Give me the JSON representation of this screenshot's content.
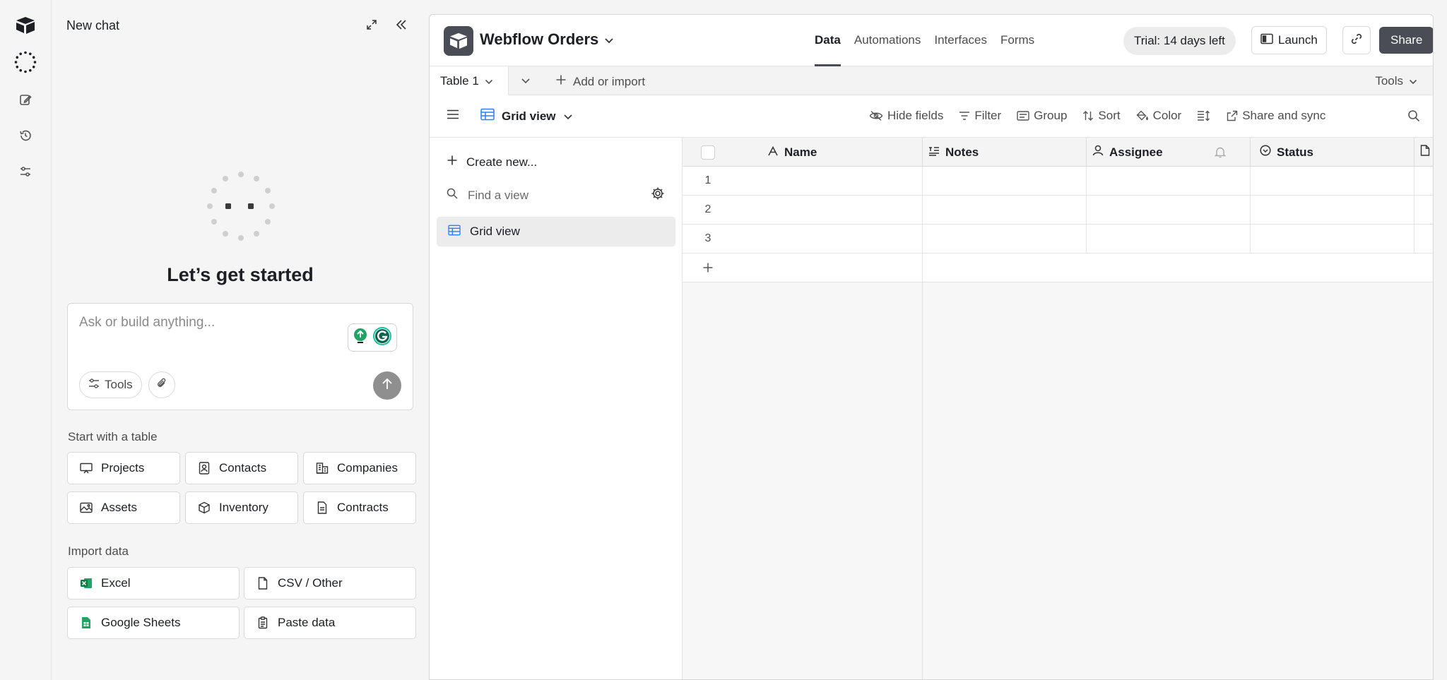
{
  "chat": {
    "title": "New chat",
    "heading": "Let’s get started",
    "prompt_placeholder": "Ask or build anything...",
    "tools_label": "Tools",
    "start_table_title": "Start with a table",
    "table_templates": [
      {
        "label": "Projects",
        "icon": "presentation-icon"
      },
      {
        "label": "Contacts",
        "icon": "contact-card-icon"
      },
      {
        "label": "Companies",
        "icon": "buildings-icon"
      },
      {
        "label": "Assets",
        "icon": "image-icon"
      },
      {
        "label": "Inventory",
        "icon": "cube-icon"
      },
      {
        "label": "Contracts",
        "icon": "document-icon"
      }
    ],
    "import_title": "Import data",
    "imports": [
      {
        "label": "Excel",
        "icon": "excel-icon",
        "color": "#1d7044"
      },
      {
        "label": "CSV / Other",
        "icon": "file-icon"
      },
      {
        "label": "Google Sheets",
        "icon": "google-sheets-icon",
        "color": "#1fa463"
      },
      {
        "label": "Paste data",
        "icon": "clipboard-icon"
      }
    ]
  },
  "base": {
    "name": "Webflow Orders",
    "tabs": [
      "Data",
      "Automations",
      "Interfaces",
      "Forms"
    ],
    "active_tab": "Data",
    "trial": "Trial: 14 days left",
    "launch_label": "Launch",
    "share_label": "Share",
    "accent": "#4a4d55"
  },
  "tablebar": {
    "table_name": "Table 1",
    "add_import": "Add or import",
    "tools": "Tools"
  },
  "viewbar": {
    "view_name": "Grid view",
    "hide_fields": "Hide fields",
    "filter": "Filter",
    "group": "Group",
    "sort": "Sort",
    "color": "Color",
    "share_sync": "Share and sync"
  },
  "sidebar": {
    "create_new": "Create new...",
    "find_placeholder": "Find a view",
    "views": [
      "Grid view"
    ]
  },
  "grid": {
    "columns": [
      "Name",
      "Notes",
      "Assignee",
      "Status"
    ],
    "rows": [
      "1",
      "2",
      "3"
    ]
  }
}
